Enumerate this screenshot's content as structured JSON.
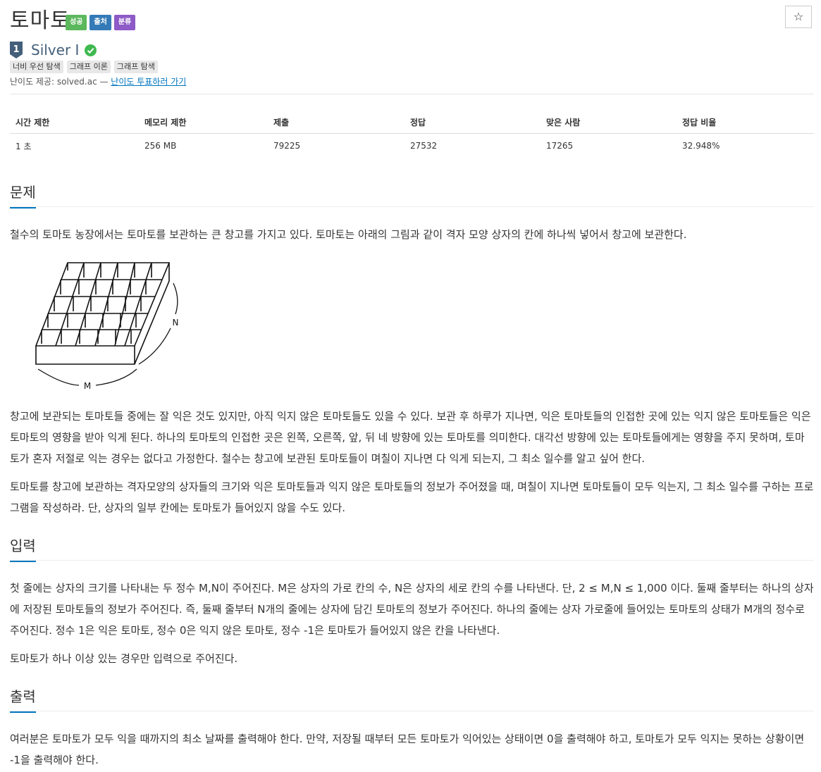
{
  "problem": {
    "title": "토마토",
    "badges": [
      {
        "label": "성공",
        "color": "#5cb85c"
      },
      {
        "label": "출처",
        "color": "#337ab7"
      },
      {
        "label": "분류",
        "color": "#8e5ac7"
      }
    ],
    "star_label": "☆"
  },
  "tier": {
    "level_number": "1",
    "label": "Silver I",
    "icon": "silver-tier-icon",
    "verified_icon": "check-circle-icon",
    "verified_color": "#3fb950"
  },
  "tags": [
    "너비 우선 탐색",
    "그래프 이론",
    "그래프 탐색"
  ],
  "difficulty_provider": {
    "prefix": "난이도 제공: solved.ac — ",
    "link_label": "난이도 투표하러 가기"
  },
  "stats": {
    "headers": [
      "시간 제한",
      "메모리 제한",
      "제출",
      "정답",
      "맞은 사람",
      "정답 비율"
    ],
    "values": [
      "1 초",
      "256 MB",
      "79225",
      "27532",
      "17265",
      "32.948%"
    ]
  },
  "sections": {
    "problem": {
      "heading": "문제",
      "intro": "철수의 토마토 농장에서는 토마토를 보관하는 큰 창고를 가지고 있다. 토마토는 아래의 그림과 같이 격자 모양 상자의 칸에 하나씩 넣어서 창고에 보관한다.",
      "figure": {
        "label_m": "M",
        "label_n": "N"
      },
      "paragraph_1": "창고에 보관되는 토마토들 중에는 잘 익은 것도 있지만, 아직 익지 않은 토마토들도 있을 수 있다. 보관 후 하루가 지나면, 익은 토마토들의 인접한 곳에 있는 익지 않은 토마토들은 익은 토마토의 영향을 받아 익게 된다. 하나의 토마토의 인접한 곳은 왼쪽, 오른쪽, 앞, 뒤 네 방향에 있는 토마토를 의미한다. 대각선 방향에 있는 토마토들에게는 영향을 주지 못하며, 토마토가 혼자 저절로 익는 경우는 없다고 가정한다. 철수는 창고에 보관된 토마토들이 며칠이 지나면 다 익게 되는지, 그 최소 일수를 알고 싶어 한다.",
      "paragraph_2": "토마토를 창고에 보관하는 격자모양의 상자들의 크기와 익은 토마토들과 익지 않은 토마토들의 정보가 주어졌을 때, 며칠이 지나면 토마토들이 모두 익는지, 그 최소 일수를 구하는 프로그램을 작성하라. 단, 상자의 일부 칸에는 토마토가 들어있지 않을 수도 있다."
    },
    "input": {
      "heading": "입력",
      "paragraph_1": "첫 줄에는 상자의 크기를 나타내는 두 정수 M,N이 주어진다. M은 상자의 가로 칸의 수, N은 상자의 세로 칸의 수를 나타낸다. 단, 2 ≤ M,N ≤ 1,000 이다. 둘째 줄부터는 하나의 상자에 저장된 토마토들의 정보가 주어진다. 즉, 둘째 줄부터 N개의 줄에는 상자에 담긴 토마토의 정보가 주어진다. 하나의 줄에는 상자 가로줄에 들어있는 토마토의 상태가 M개의 정수로 주어진다. 정수 1은 익은 토마토, 정수 0은 익지 않은 토마토, 정수 -1은 토마토가 들어있지 않은 칸을 나타낸다.",
      "paragraph_2": "토마토가 하나 이상 있는 경우만 입력으로 주어진다."
    },
    "output": {
      "heading": "출력",
      "paragraph_1": "여러분은 토마토가 모두 익을 때까지의 최소 날짜를 출력해야 한다. 만약, 저장될 때부터 모든 토마토가 익어있는 상태이면 0을 출력해야 하고, 토마토가 모두 익지는 못하는 상황이면 -1을 출력해야 한다."
    }
  }
}
